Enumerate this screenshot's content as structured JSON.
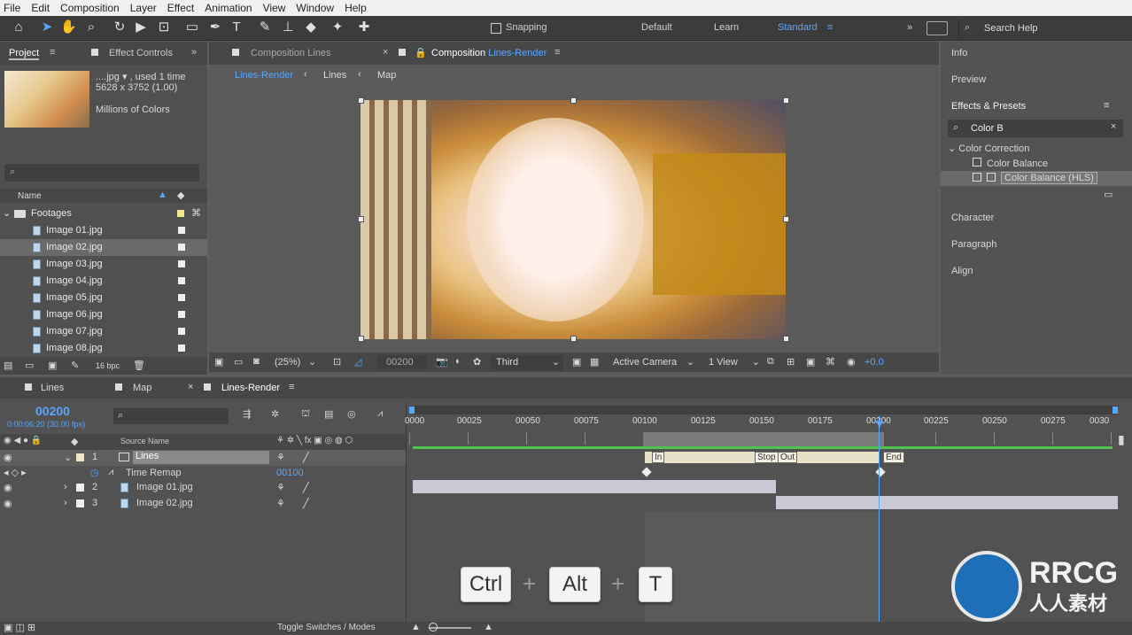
{
  "menu": [
    "File",
    "Edit",
    "Composition",
    "Layer",
    "Effect",
    "Animation",
    "View",
    "Window",
    "Help"
  ],
  "toolbar": {
    "snapping": "Snapping",
    "workspaces": [
      "Default",
      "Learn",
      "Standard"
    ],
    "search": "Search Help"
  },
  "project": {
    "tab": "Project",
    "effect_controls": "Effect Controls",
    "file_name": "....jpg",
    "used": ", used 1 time",
    "dimensions": "5628 x 3752 (1.00)",
    "colors": "Millions of Colors",
    "name_header": "Name",
    "folder": "Footages",
    "files": [
      "Image 01.jpg",
      "Image 02.jpg",
      "Image 03.jpg",
      "Image 04.jpg",
      "Image 05.jpg",
      "Image 06.jpg",
      "Image 07.jpg",
      "Image 08.jpg"
    ],
    "bpc": "16 bpc"
  },
  "comp_tabs": {
    "tab1_prefix": "Composition",
    "tab1_name": "Lines",
    "tab2_prefix": "Composition",
    "tab2_name": "Lines-Render",
    "crumbs": [
      "Lines-Render",
      "Lines",
      "Map"
    ]
  },
  "viewer": {
    "zoom": "(25%)",
    "timecode": "00200",
    "resolution": "Third",
    "camera": "Active Camera",
    "views": "1 View",
    "exposure": "+0.0"
  },
  "right": {
    "info": "Info",
    "preview": "Preview",
    "effects_presets": "Effects & Presets",
    "search_value": "Color B",
    "category": "Color Correction",
    "items": [
      "Color Balance",
      "Color Balance (HLS)"
    ],
    "character": "Character",
    "paragraph": "Paragraph",
    "align": "Align"
  },
  "timeline": {
    "tabs": [
      "Lines",
      "Map",
      "Lines-Render"
    ],
    "current": "00200",
    "sub": "0:00:06:20 (30.00 fps)",
    "source_header": "Source Name",
    "layers": [
      {
        "num": "1",
        "name": "Lines"
      },
      {
        "num": "2",
        "name": "Image 01.jpg"
      },
      {
        "num": "3",
        "name": "Image 02.jpg"
      }
    ],
    "time_remap": "Time Remap",
    "remap_value": "00100",
    "ruler": [
      "0000",
      "00025",
      "00050",
      "00075",
      "00100",
      "00125",
      "00150",
      "00175",
      "00200",
      "00225",
      "00250",
      "00275",
      "0030"
    ],
    "markers": [
      "In",
      "Stop",
      "Out",
      "End"
    ],
    "toggle": "Toggle Switches / Modes"
  },
  "shortcut": {
    "k1": "Ctrl",
    "k2": "Alt",
    "k3": "T",
    "plus": "+"
  },
  "logo": {
    "text": "RRCG",
    "sub": "人人素材"
  },
  "colors": {
    "accent": "#58a6ff",
    "green_bar": "#4fc24f",
    "layer_bar": "#c9c9d6",
    "marker_bar": "#e9e0c8"
  }
}
